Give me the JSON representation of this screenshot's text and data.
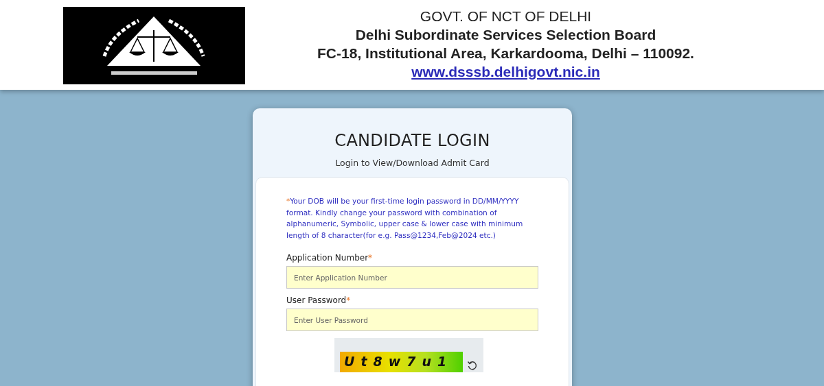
{
  "header": {
    "lines": [
      "GOVT. OF NCT OF DELHI",
      "Delhi Subordinate Services Selection Board",
      "FC-18, Institutional Area, Karkardooma, Delhi – 110092."
    ],
    "website": "www.dsssb.delhigovt.nic.in"
  },
  "login": {
    "title": "CANDIDATE LOGIN",
    "subtitle": "Login to View/Download Admit Card",
    "notice": {
      "mark": "*",
      "text": "Your DOB will be your first-time login password in DD/MM/YYYY format. Kindly change your password with combination of alphanumeric, Symbolic, upper case & lower case with minimum length of 8 character(for e.g. Pass@1234,Feb@2024 etc.)"
    },
    "fields": [
      {
        "label": "Application Number",
        "required": "*",
        "placeholder": "Enter Application Number"
      },
      {
        "label": "User Password",
        "required": "*",
        "placeholder": "Enter User Password"
      }
    ],
    "captcha": "Ut8w7u1"
  }
}
